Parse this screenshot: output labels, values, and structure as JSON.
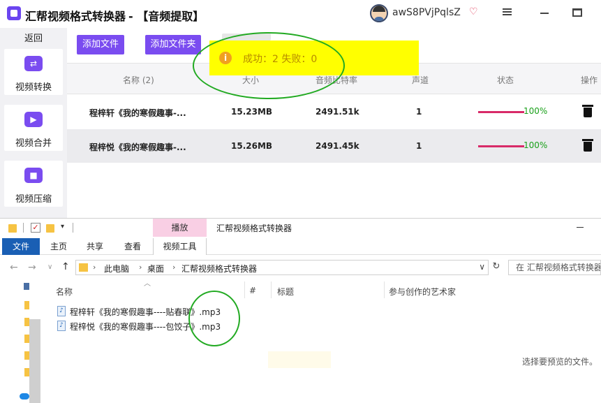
{
  "app": {
    "title": "汇帮视频格式转换器",
    "mode": "-  【音频提取】",
    "username": "awS8PVjPqlsZ"
  },
  "sidebar": {
    "back": "返回",
    "items": [
      {
        "label": "视频转换",
        "icon": "video-convert-icon"
      },
      {
        "label": "视频合并",
        "icon": "video-merge-icon"
      },
      {
        "label": "视频压缩",
        "icon": "video-compress-icon"
      }
    ]
  },
  "toolbar": {
    "add_file": "添加文件",
    "add_folder": "添加文件夹"
  },
  "toast": {
    "text": "成功：2    失败：0"
  },
  "table": {
    "headers": [
      "名称 (2)",
      "大小",
      "音频比特率",
      "声道",
      "状态",
      "操作"
    ],
    "rows": [
      {
        "name": "程梓轩《我的寒假趣事-...",
        "size": "15.23MB",
        "bitrate": "2491.51k",
        "channels": "1",
        "progress": 100,
        "progress_text": "100%"
      },
      {
        "name": "程梓悦《我的寒假趣事-...",
        "size": "15.26MB",
        "bitrate": "2491.45k",
        "channels": "1",
        "progress": 100,
        "progress_text": "100%"
      }
    ]
  },
  "explorer": {
    "context_tab": "播放",
    "title": "汇帮视频格式转换器",
    "ribbon_tabs": [
      "文件",
      "主页",
      "共享",
      "查看",
      "视频工具"
    ],
    "breadcrumb": [
      "此电脑",
      "桌面",
      "汇帮视频格式转换器"
    ],
    "search_placeholder": "在 汇帮视频格式转换器",
    "columns": [
      "名称",
      "#",
      "标题",
      "参与创作的艺术家"
    ],
    "files": [
      "程梓轩《我的寒假趣事----贴春联》.mp3",
      "程梓悦《我的寒假趣事----包饺子》.mp3"
    ],
    "preview_message": "选择要预览的文件。"
  },
  "colors": {
    "accent": "#7a4cf0",
    "toast_bg": "#ffff00",
    "progress": "#d82a68",
    "success_text": "#19a019",
    "annotation": "#22aa22"
  }
}
